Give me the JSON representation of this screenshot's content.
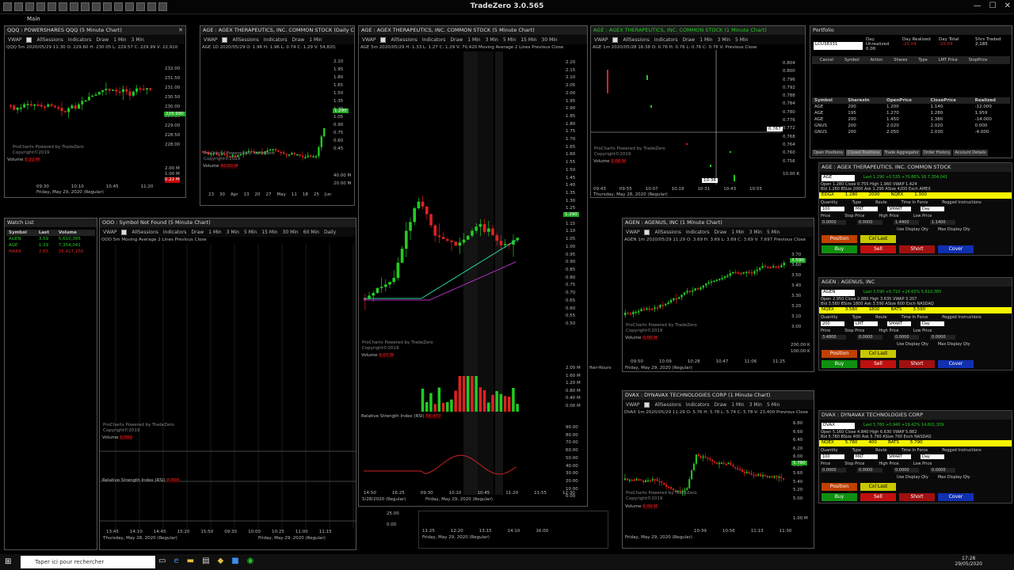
{
  "app": {
    "title": "TradeZero 3.0.565",
    "menu": "Main",
    "win_min": "—",
    "win_max": "☐",
    "win_close": "✕"
  },
  "colors": {
    "up": "#22cc22",
    "down": "#dd2222",
    "bg": "#000000"
  },
  "toolbar_items": [
    "VWAP",
    "AllSessions",
    "Indicators",
    "Draw",
    "1 Min",
    "3 Min",
    "5 Min",
    "15 Min",
    "30 Min",
    "60 Min",
    "Daily"
  ],
  "charts": {
    "qqq": {
      "title": "QQQ : POWERSHARES QQQ (5 Minute Chart)",
      "ohlc": "QQQ 5m  2020/05/29 11:30  O: 229.60  H: 230.05  L: 229.57  C: 229.99  V: 22,910",
      "prices": [
        "232.00",
        "231.50",
        "231.00",
        "230.50",
        "230.00",
        "229.50",
        "229.00",
        "228.50",
        "228.00"
      ],
      "last": "229.990",
      "vol": [
        "2.00 M",
        "1.00 M",
        "0.22 M"
      ],
      "xlabels": [
        "09:30",
        "10:10",
        "10:45",
        "11:20"
      ],
      "date": "Friday, May 29, 2020 (Regular)",
      "powered": "ProCharts Powered by TradeZero",
      "copyright": "Copyright©2019",
      "volume_label": "Volume",
      "volume_val": "0.22 M"
    },
    "age1d": {
      "title": "AGE : AGEX THERAPEUTICS, INC. COMMON STOCK (Daily Chart)",
      "ohlc": "AGE 1D  2020/05/29  O: 1.96  H: 1.96  L: 0.74  C: 1.29  V: 54,820,",
      "prices": [
        "2.10",
        "1.95",
        "1.80",
        "1.65",
        "1.50",
        "1.35",
        "1.20",
        "1.05",
        "0.90",
        "0.75",
        "0.60",
        "0.45"
      ],
      "last": "1.290",
      "vol": [
        "40.00 M",
        "20.00 M"
      ],
      "xlabels": [
        "23",
        "30",
        "Apr",
        "13",
        "20",
        "27",
        "May",
        "11",
        "18",
        "25",
        "Jun"
      ],
      "powered": "ProCharts Powered by TradeZero",
      "copyright": "Copyright©2019",
      "volume_label": "Volume",
      "volume_val": "40.00 M"
    },
    "age5m": {
      "title": "AGE : AGEX THERAPEUTICS, INC. COMMON STOCK (5 Minute Chart)",
      "ohlc": "AGE 5m  2020/05/29  H: 1.33  L: 1.27  C: 1.29  V: 70,420",
      "ma": "Moving Average 2 Lines",
      "prev": "Previous Close",
      "prices": [
        "2.20",
        "2.15",
        "2.10",
        "2.05",
        "2.00",
        "1.95",
        "1.90",
        "1.85",
        "1.80",
        "1.75",
        "1.70",
        "1.65",
        "1.60",
        "1.55",
        "1.50",
        "1.45",
        "1.40",
        "1.35",
        "1.30",
        "1.25",
        "1.20",
        "1.15",
        "1.10",
        "1.05",
        "1.00",
        "0.95",
        "0.90",
        "0.85",
        "0.80",
        "0.75",
        "0.70",
        "0.65",
        "0.60",
        "0.55",
        "0.50"
      ],
      "last": "1.290",
      "vol": [
        "2.00 M",
        "1.60 M",
        "1.20 M",
        "0.80 M",
        "0.40 M",
        "0.00 M"
      ],
      "rsi": [
        "90.00",
        "80.00",
        "70.00",
        "60.00",
        "50.00",
        "40.00",
        "30.00",
        "20.00",
        "10.00",
        "0.00"
      ],
      "xlabels": [
        "14:50",
        "16:25",
        "09:30",
        "10:10",
        "10:45",
        "11:20",
        "11:55",
        "12:30"
      ],
      "date1": "5/28/2020 (Regular)",
      "date2": "Friday, May 29, 2020 (Regular)",
      "rsi_label": "Relative Strength Index (RSI)",
      "rsi_val": "56.477",
      "powered": "ProCharts Powered by TradeZero",
      "copyright": "Copyright©2019",
      "volume_label": "Volume",
      "volume_val": "0.07 M"
    },
    "age1m": {
      "title": "AGE : AGEX THERAPEUTICS, INC. COMMON STOCK (1 Minute Chart)",
      "ohlc": "AGE 1m  2020/05/28 16:38  O: 0.76  H: 0.76  L: 0.76  C: 0.76  V:",
      "prev": "Previous Close",
      "prices": [
        "0.804",
        "0.800",
        "0.796",
        "0.792",
        "0.788",
        "0.784",
        "0.780",
        "0.776",
        "0.772",
        "0.768",
        "0.764",
        "0.760",
        "0.756"
      ],
      "last": "0.767",
      "vol": [
        "10.00 K"
      ],
      "xlabels": [
        "09:43",
        "09:55",
        "10:07",
        "10:19",
        "10:31",
        "10:43",
        "10:55"
      ],
      "crosshair": "10:36",
      "date": "Thursday, May 28, 2020 (Regular)",
      "powered": "ProCharts Powered by TradeZero",
      "copyright": "Copyright©2019",
      "volume_label": "Volume",
      "volume_val": "0.00 M"
    },
    "ooo": {
      "title": "OOO : Symbol Not Found (5 Minute Chart)",
      "ohlc": "OOO 5m",
      "ma": "Moving Average 2 Lines",
      "prev": "Previous Close",
      "xlabels": [
        "13:45",
        "14:10",
        "14:45",
        "15:20",
        "15:50",
        "09:30",
        "10:00",
        "10:25",
        "11:00",
        "11:15"
      ],
      "date1": "Thursday, May 28, 2020 (Regular)",
      "date2": "Friday, May 29, 2020 (Regular)",
      "rsi_label": "Relative Strength Index (RSI)",
      "rsi_val": "0.000",
      "volume_label": "Volume",
      "volume_val": "0.000",
      "powered": "ProCharts Powered by TradeZero",
      "copyright": "Copyright©2019",
      "val2": "25.00",
      "val3": "0.00"
    },
    "agen": {
      "title": "AGEN : AGENUS, INC (1 Minute Chart)",
      "ohlc": "AGEN 1m  2020/05/29 11:29  O: 3.69  H: 3.69  L: 3.69  C: 3.69  V: 7,697",
      "prev": "Previous Close",
      "prices": [
        "3.70",
        "3.60",
        "3.50",
        "3.40",
        "3.30",
        "3.20",
        "3.10",
        "3.00"
      ],
      "last": "3.590",
      "vol": [
        "200.00 K",
        "100.00 K"
      ],
      "xlabels": [
        "09:50",
        "10:09",
        "10:28",
        "10:47",
        "11:06",
        "11:25"
      ],
      "date": "Friday, May 29, 2020 (Regular)",
      "powered": "ProCharts Powered by TradeZero",
      "copyright": "Copyright©2019",
      "volume_label": "Volume",
      "volume_val": "0.00 M"
    },
    "dvax": {
      "title": "DVAX : DYNAVAX TECHNOLOGIES CORP (1 Minute Chart)",
      "ohlc": "DVAX 1m  2020/05/29 11:29  O: 5.76  H: 5.78  L: 5.74  C: 5.78  V: 23,400",
      "prev": "Previous Close",
      "prices": [
        "6.80",
        "6.60",
        "6.40",
        "6.20",
        "6.00",
        "5.80",
        "5.60",
        "5.40",
        "5.20",
        "5.00"
      ],
      "last": "5.780",
      "vol": [
        "1.00 M"
      ],
      "xlabels": [
        "10:39",
        "10:56",
        "11:13",
        "11:30"
      ],
      "date": "Friday, May 29, 2020 (Regular)",
      "powered": "ProCharts Powered by TradeZero",
      "copyright": "Copyright©2019",
      "volume_label": "Volume",
      "volume_val": "0.00 M"
    },
    "hidden": {
      "xlabels": [
        "11:25",
        "12:20",
        "13:15",
        "14:10",
        "16:00"
      ],
      "date": "Friday, May 29, 2020 (Regular)",
      "extra": "fter-Hours"
    }
  },
  "watchlist": {
    "title": "Watch List",
    "headers": [
      "Symbol",
      "Last",
      "Volume"
    ],
    "rows": [
      [
        "AGEN",
        "3.59",
        "5,610,385",
        "#22cc22"
      ],
      [
        "AGE",
        "1.29",
        "7,354,041",
        "#22cc22"
      ],
      [
        "MARK",
        "2.65",
        "26,417,156",
        "#dd2222"
      ]
    ]
  },
  "portfolio": {
    "title": "Portfolio",
    "account": "LCU38331",
    "fields": [
      [
        "Day Unrealized",
        "0.00",
        "#dddddd"
      ],
      [
        "Day Realized",
        "-20.04",
        "#dd2222"
      ],
      [
        "Day Total",
        "-20.04",
        "#dd2222"
      ],
      [
        "Shrs Traded",
        "2,185",
        "#dddddd"
      ]
    ],
    "order_cols": [
      "Cancel",
      "Symbol",
      "Action",
      "Shares",
      "Type",
      "LMT Price",
      "StopPrice"
    ],
    "cols": [
      "Symbol",
      "SharesIn",
      "OpenPrice",
      "ClosePrice",
      "Realized"
    ],
    "rows": [
      [
        "AGE",
        "200",
        "1.200",
        "1.140",
        "-12.000"
      ],
      [
        "AGE",
        "195",
        "1.270",
        "1.280",
        "1.959"
      ],
      [
        "AGE",
        "200",
        "1.450",
        "1.380",
        "-14.000"
      ],
      [
        "GNUS",
        "200",
        "2.020",
        "2.020",
        "0.000"
      ],
      [
        "GNUS",
        "200",
        "2.050",
        "2.030",
        "-4.000"
      ]
    ],
    "tabs": [
      "Open Positions",
      "Closed Positions",
      "Trade Aggregator",
      "Order History",
      "Account Details"
    ]
  },
  "tickets": [
    {
      "title": "AGE : AGEX THERAPEUTICS, INC. COMMON STOCK",
      "sym": "AGE",
      "line1": "Last  1.290   +0.535  +70.86%    18  7,354,041",
      "line2": "Open  1.280  Close  0.755  High  1.960  VWAP  1.424",
      "line3": "Bid  1.280  BSize  2000  Ask  1.290  ASize  4200  Exch  AMEX",
      "ecn": "EDGX",
      "ecnq": "1.280",
      "ecnsz": "2000",
      "ecn2": "NQEX",
      "ecn2q": "1.300",
      "qty": "100",
      "type": "MKT",
      "route": "SMART",
      "tif": "Day",
      "price": "0.0000",
      "stop": "0.0000",
      "high": "1.4400",
      "low": "1.1400"
    },
    {
      "title": "AGEN : AGENUS, INC",
      "sym": "AGEN",
      "line1": "Last  3.590   +0.710  +24.65%         5,610,385",
      "line2": "Open  2.950  Close  2.880  High  3.635  VWAP  3.207",
      "line3": "Bid  3.580  BSize  1800  Ask  3.590  ASize  600  Exch  NASDAQ",
      "ecn": "NQEX",
      "ecnq": "3.580",
      "ecnsz": "1800",
      "ecn2": "BATS",
      "ecn2q": "3.590",
      "qty": "200",
      "type": "LMT",
      "route": "SMART",
      "tif": "Day",
      "price": "3.4800",
      "stop": "0.0000",
      "high": "0.0000",
      "low": "0.0000"
    },
    {
      "title": "DVAX : DYNAVAX TECHNOLOGIES CORP",
      "sym": "DVAX",
      "line1": "Last  5.760   +0.940  +19.42%        14,601,309",
      "line2": "Open  5.160  Close  4.840  High  6.630  VWAP  5.882",
      "line3": "Bid  5.780  BSize  400  Ask  5.790  ASize  700  Exch  NASDAQ",
      "ecn": "NQEX",
      "ecnq": "5.780",
      "ecnsz": "400",
      "ecn2": "BATS",
      "ecn2q": "5.790",
      "qty": "100",
      "type": "MKT",
      "route": "SMART",
      "tif": "Day",
      "price": "0.0000",
      "stop": "0.0000",
      "high": "0.0000",
      "low": "0.0000"
    }
  ],
  "ticket_labels": {
    "qty": "Quantity",
    "type": "Type",
    "route": "Route",
    "tif": "Time In Force",
    "peg": "Pegged Instructions",
    "price": "Price",
    "stop": "Stop Price",
    "high": "High Price",
    "low": "Low Price",
    "disp": "Use Display Qty",
    "maxdisp": "Max Display Qty",
    "position": "Position",
    "cxl": "Cxl Last",
    "buy": "Buy",
    "sell": "Sell",
    "short": "Short",
    "cover": "Cover"
  },
  "taskbar": {
    "search": "Taper ici pour rechercher",
    "time": "17:28",
    "date": "29/05/2020"
  }
}
